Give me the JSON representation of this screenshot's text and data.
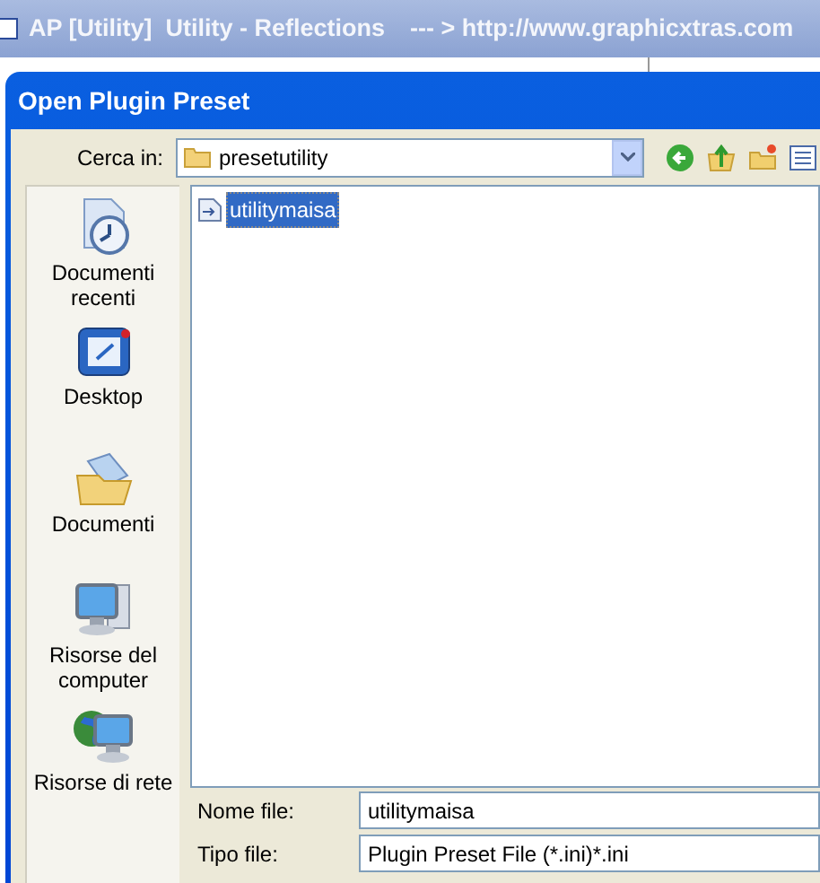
{
  "app_window": {
    "title": "AP [Utility]  Utility - Reflections",
    "url_text": "--- > http://www.graphicxtras.com"
  },
  "dialog": {
    "title": "Open Plugin Preset",
    "look_in": {
      "label": "Cerca in:",
      "value": "presetutility"
    },
    "places": [
      {
        "kind": "recent",
        "label": "Documenti recenti"
      },
      {
        "kind": "desktop",
        "label": "Desktop"
      },
      {
        "kind": "documents",
        "label": "Documenti"
      },
      {
        "kind": "computer",
        "label": "Risorse del computer"
      },
      {
        "kind": "network",
        "label": "Risorse di rete"
      }
    ],
    "files": [
      {
        "name": "utilitymaisa",
        "selected": true
      }
    ],
    "file_name": {
      "label": "Nome file:",
      "value": "utilitymaisa"
    },
    "file_type": {
      "label": "Tipo file:",
      "value": "Plugin Preset File (*.ini)*.ini"
    }
  }
}
